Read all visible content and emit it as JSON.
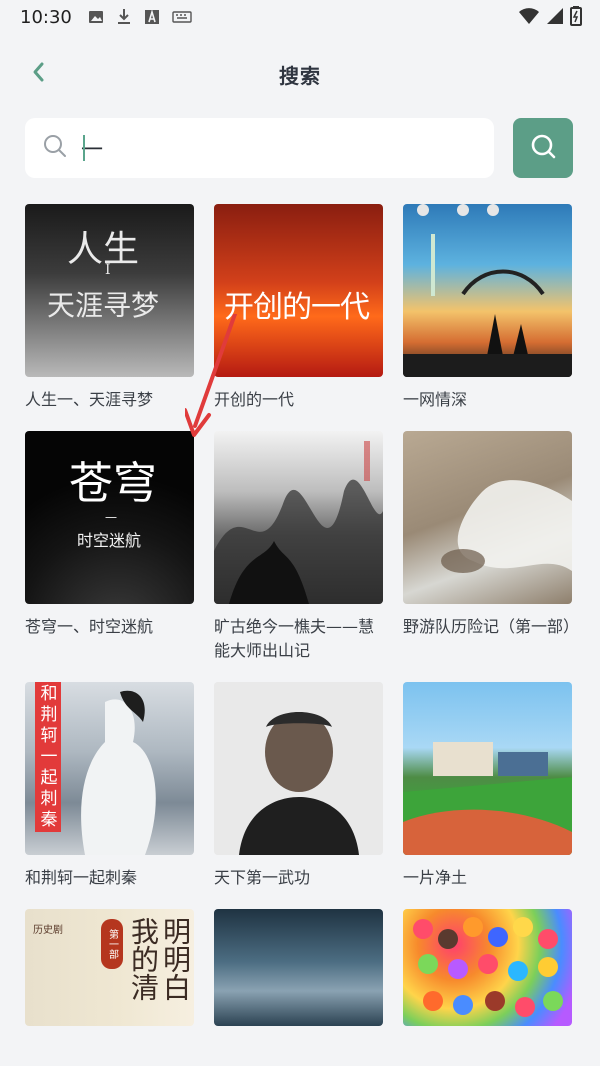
{
  "status_bar": {
    "time": "10:30",
    "icons": [
      "image-icon",
      "download-icon",
      "text-a-icon",
      "keyboard-icon"
    ],
    "right_icons": [
      "wifi-icon",
      "signal-icon",
      "battery-icon"
    ]
  },
  "header": {
    "title": "搜索",
    "back_icon": "chevron-left-icon"
  },
  "search": {
    "value": "一",
    "placeholder": "",
    "search_icon": "search-icon",
    "button_icon": "search-icon"
  },
  "colors": {
    "accent": "#5c9e87",
    "background": "#f3f4f6",
    "annotation_arrow": "#e03b3b"
  },
  "results": [
    {
      "title": "人生一、天涯寻梦",
      "cover_text": [
        "人生",
        "I",
        "天涯寻梦"
      ]
    },
    {
      "title": "开创的一代",
      "cover_text": [
        "开创的一代"
      ]
    },
    {
      "title": "一网情深",
      "cover_text": []
    },
    {
      "title": "苍穹一、时空迷航",
      "cover_text": [
        "苍穹",
        "一",
        "时空迷航"
      ]
    },
    {
      "title": "旷古绝今一樵夫——慧能大师出山记",
      "cover_text": []
    },
    {
      "title": "野游队历险记（第一部）",
      "cover_text": []
    },
    {
      "title": "和荆轲一起刺秦",
      "cover_text": [
        "和",
        "荆",
        "轲",
        "一",
        "起",
        "刺",
        "秦"
      ]
    },
    {
      "title": "天下第一武功",
      "cover_text": []
    },
    {
      "title": "一片净土",
      "cover_text": []
    },
    {
      "title": "",
      "cover_text": [
        "历史剧",
        "第一部",
        "我的清",
        "明明白"
      ]
    },
    {
      "title": "",
      "cover_text": []
    },
    {
      "title": "",
      "cover_text": []
    }
  ]
}
